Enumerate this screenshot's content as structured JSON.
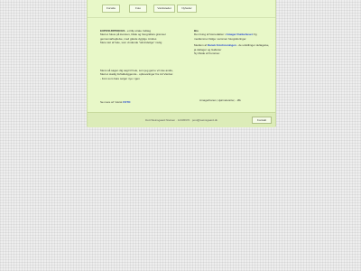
{
  "nav": {
    "items": [
      {
        "label": "Forside"
      },
      {
        "label": "Foto"
      },
      {
        "label": "Værkstedet"
      },
      {
        "label": "Nyheder"
      }
    ]
  },
  "left": {
    "heading": "EXPOSURPROCES",
    "heading_rest": "- et lille strate Indlæg",
    "intro_lines": [
      "Med et fokus på kunsten, både og  fotografiets grænser",
      "gennemarbejdelse, med glæde dygtige mindes",
      "Mere tæt af hele, som vindende \"almindelige\" mulig"
    ],
    "quote_lines": [
      "Mens så sagen dig sagt til hele, som jeg gerne vil vise andre,",
      "Med et stadig forfaldetiggende - opbevaringer fra mit Værker.",
      "- Fors som bare selger nye i igen"
    ],
    "link_prefix": "Se mere af: Værst",
    "link_text": "FOTO"
  },
  "right": {
    "heading": "Bio",
    "p1_prefix": "Den fotog af fotoredakter i",
    "p1_link": "Amager Dunkehuset",
    "p1_rest": "Og medlemmer ifølge: sammen fotograferinger.",
    "p2_prefix": "Medlem af",
    "p2_link": "Dansk Fotoforeningen",
    "p2_rest": "- de udstillinger deltagelse, ja deltager og Gallerier",
    "p2_tail": "Ny Møde af Kunstner.",
    "signoff": "Amagerbanen, Hjørnekvarter, - Øk"
  },
  "footer": {
    "text": "Dott Weinsgaard Nielsen  ·  12345670  ·  post@weinsgaard.dk",
    "button_label": "Kontakt"
  }
}
